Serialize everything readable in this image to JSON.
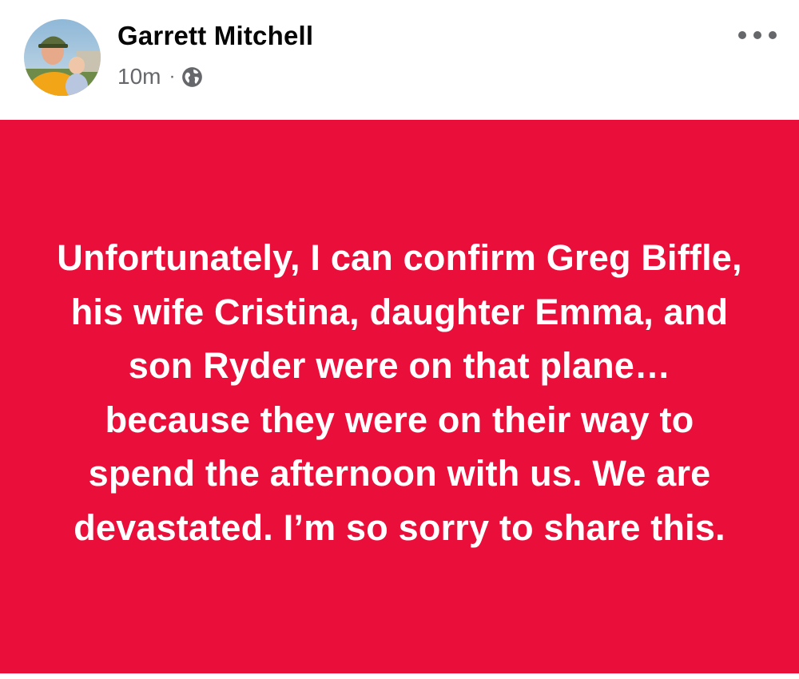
{
  "post": {
    "author": {
      "name": "Garrett Mitchell",
      "avatar_icon": "profile-photo"
    },
    "timestamp": "10m",
    "separator": "·",
    "privacy_icon": "globe-icon",
    "more_icon": "more-options-icon",
    "body": {
      "text": "Unfortunately, I can confirm Greg Biffle, his wife Cristina, daughter Emma, and son Ryder were on that plane… because they were on their way to spend the afternoon with us. We are devastated. I’m so sorry to share this.",
      "background_color": "#ea0e3b",
      "text_color": "#ffffff"
    }
  },
  "colors": {
    "header_background": "#ffffff",
    "name_text": "#050505",
    "meta_text": "#65676b"
  }
}
